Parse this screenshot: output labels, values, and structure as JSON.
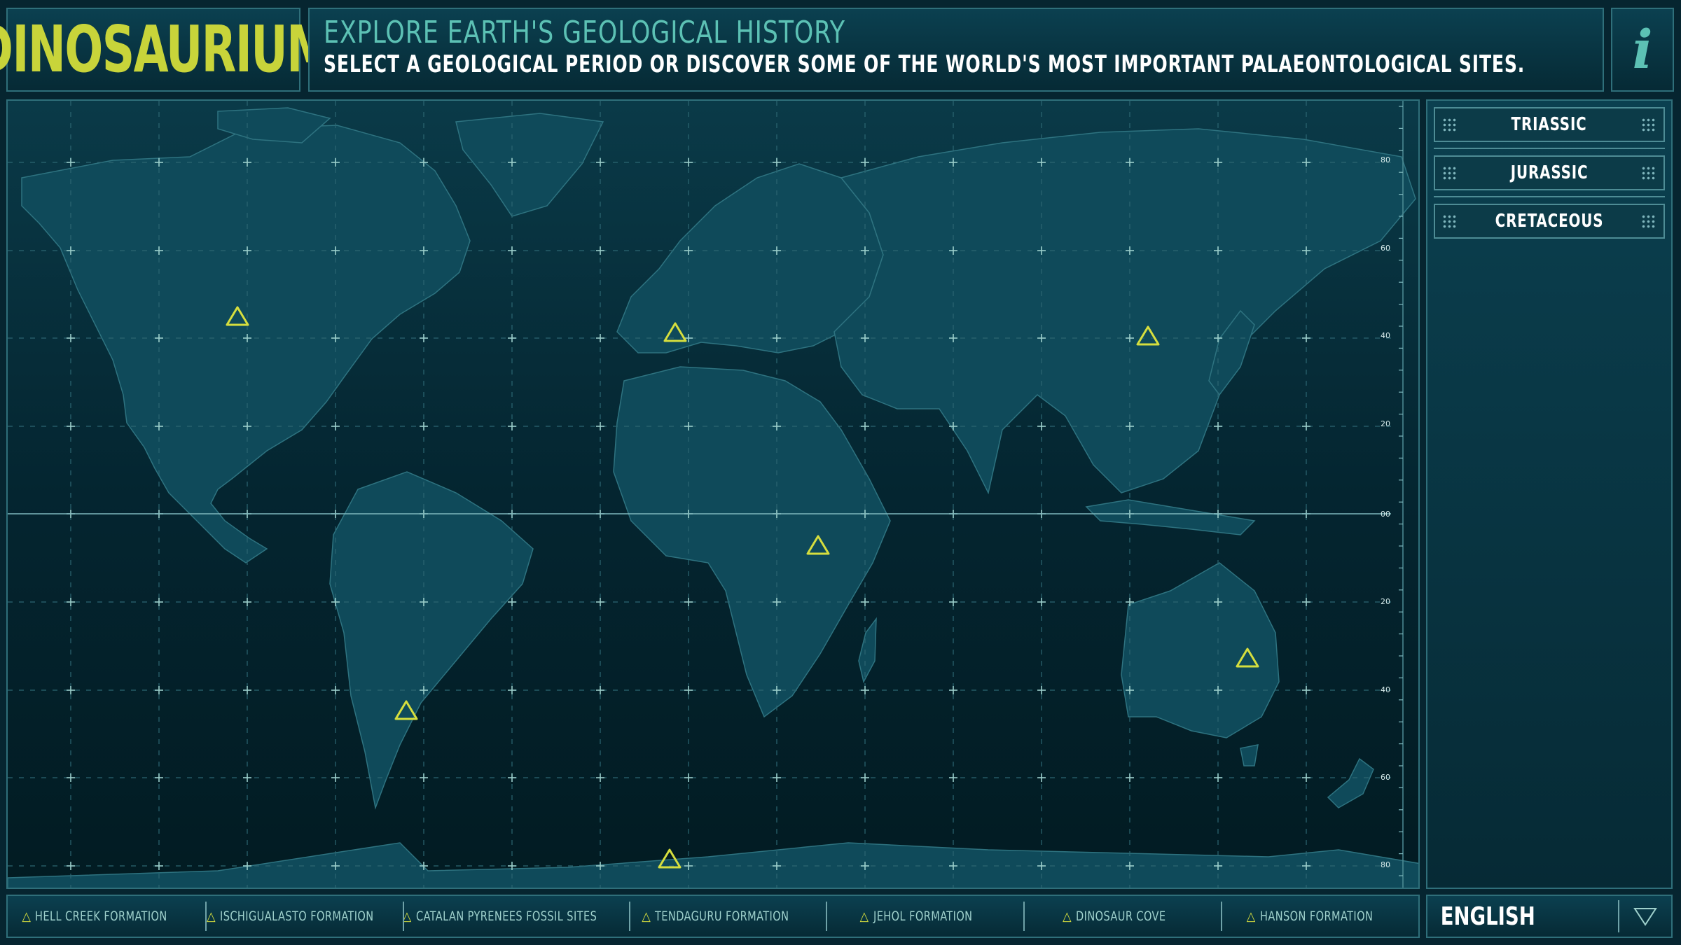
{
  "app": {
    "logo": "DINOSAURIUM",
    "info_icon": "info-icon"
  },
  "header": {
    "title": "EXPLORE EARTH'S GEOLOGICAL HISTORY",
    "subtitle": "SELECT A GEOLOGICAL PERIOD OR DISCOVER SOME OF THE WORLD'S MOST IMPORTANT PALAEONTOLOGICAL SITES."
  },
  "map": {
    "latitude_labels": [
      "80",
      "60",
      "40",
      "20",
      "00",
      "20",
      "40",
      "60",
      "80"
    ],
    "site_marker_icon": "triangle-outline-icon"
  },
  "periods": [
    "TRIASSIC",
    "JURASSIC",
    "CRETACEOUS"
  ],
  "sites": [
    "HELL CREEK FORMATION",
    "ISCHIGUALASTO FORMATION",
    "CATALAN PYRENEES FOSSIL SITES",
    "TENDAGURU FORMATION",
    "JEHOL FORMATION",
    "DINOSAUR COVE",
    "HANSON FORMATION"
  ],
  "language": {
    "selected": "ENGLISH",
    "dropdown_icon": "chevron-down-icon"
  },
  "colors": {
    "accent_yellow": "#d6de3e",
    "accent_teal": "#5cc1b4",
    "land": "#0f4a5a",
    "ocean": "#04232c"
  }
}
